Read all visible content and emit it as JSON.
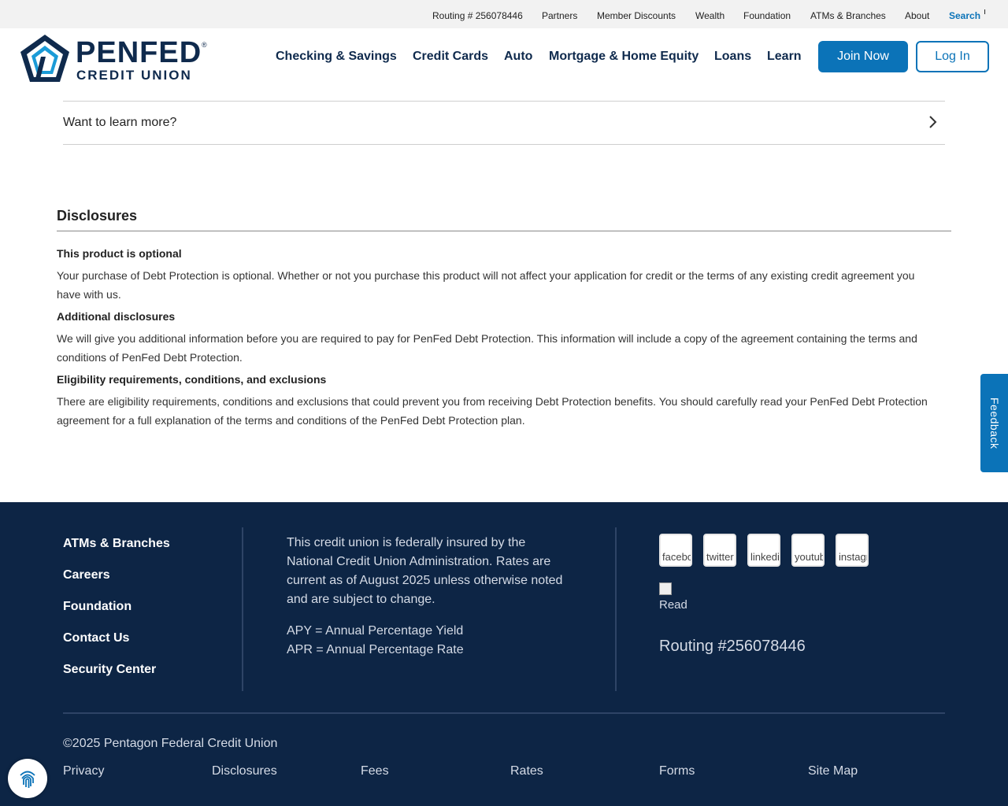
{
  "utility": {
    "routing": "Routing # 256078446",
    "links": [
      "Partners",
      "Member Discounts",
      "Wealth",
      "Foundation",
      "ATMs & Branches",
      "About"
    ],
    "search_label": "Search",
    "search_icon": "search-icon"
  },
  "logo": {
    "pen": "PEN",
    "fed": "FED",
    "credit_union": "CREDIT UNION",
    "reg": "®",
    "icon": "pentagon-logo-icon"
  },
  "nav": {
    "items": [
      "Checking & Savings",
      "Credit Cards",
      "Auto",
      "Mortgage & Home Equity",
      "Loans",
      "Learn"
    ],
    "join_label": "Join Now",
    "login_label": "Log In"
  },
  "accordion": {
    "label": "Want to learn more?",
    "icon": "chevron-right-icon"
  },
  "disclosures": {
    "title": "Disclosures",
    "sections": [
      {
        "heading": "This product is optional",
        "body": "Your purchase of Debt Protection is optional. Whether or not you purchase this product will not affect your application for credit or the terms of any existing credit agreement you have with us."
      },
      {
        "heading": "Additional disclosures",
        "body": "We will give you additional information before you are required to pay for PenFed Debt Protection. This information will include a copy of the agreement containing the terms and conditions of PenFed Debt Protection."
      },
      {
        "heading": "Eligibility requirements, conditions, and exclusions",
        "body": "There are eligibility requirements, conditions and exclusions that could prevent you from receiving Debt Protection benefits. You should carefully read your PenFed Debt Protection agreement for a full explanation of the terms and conditions of the PenFed Debt Protection plan."
      }
    ]
  },
  "feedback_label": "Feedback",
  "footer": {
    "links": [
      "ATMs & Branches",
      "Careers",
      "Foundation",
      "Contact Us",
      "Security Center"
    ],
    "insurance_text": "This credit union is federally insured by the National Credit Union Administration. Rates are current as of August 2025 unless otherwise noted and are subject to change.",
    "apy": "APY = Annual Percentage Yield",
    "apr": "APR = Annual Percentage Rate",
    "social_alts": [
      "facebook",
      "twitter",
      "linkedin",
      "youtube",
      "instagram"
    ],
    "read_alt": "Read",
    "routing": "Routing #256078446",
    "copyright": "©2025 Pentagon Federal Credit Union",
    "bottom_links": [
      "Privacy",
      "Disclosures",
      "Fees",
      "Rates",
      "Forms",
      "Site Map"
    ]
  },
  "fingerprint_icon": "fingerprint-icon",
  "colors": {
    "brand_navy": "#0d2545",
    "brand_blue": "#0b73b8",
    "footer_text": "#d5dbe6"
  }
}
